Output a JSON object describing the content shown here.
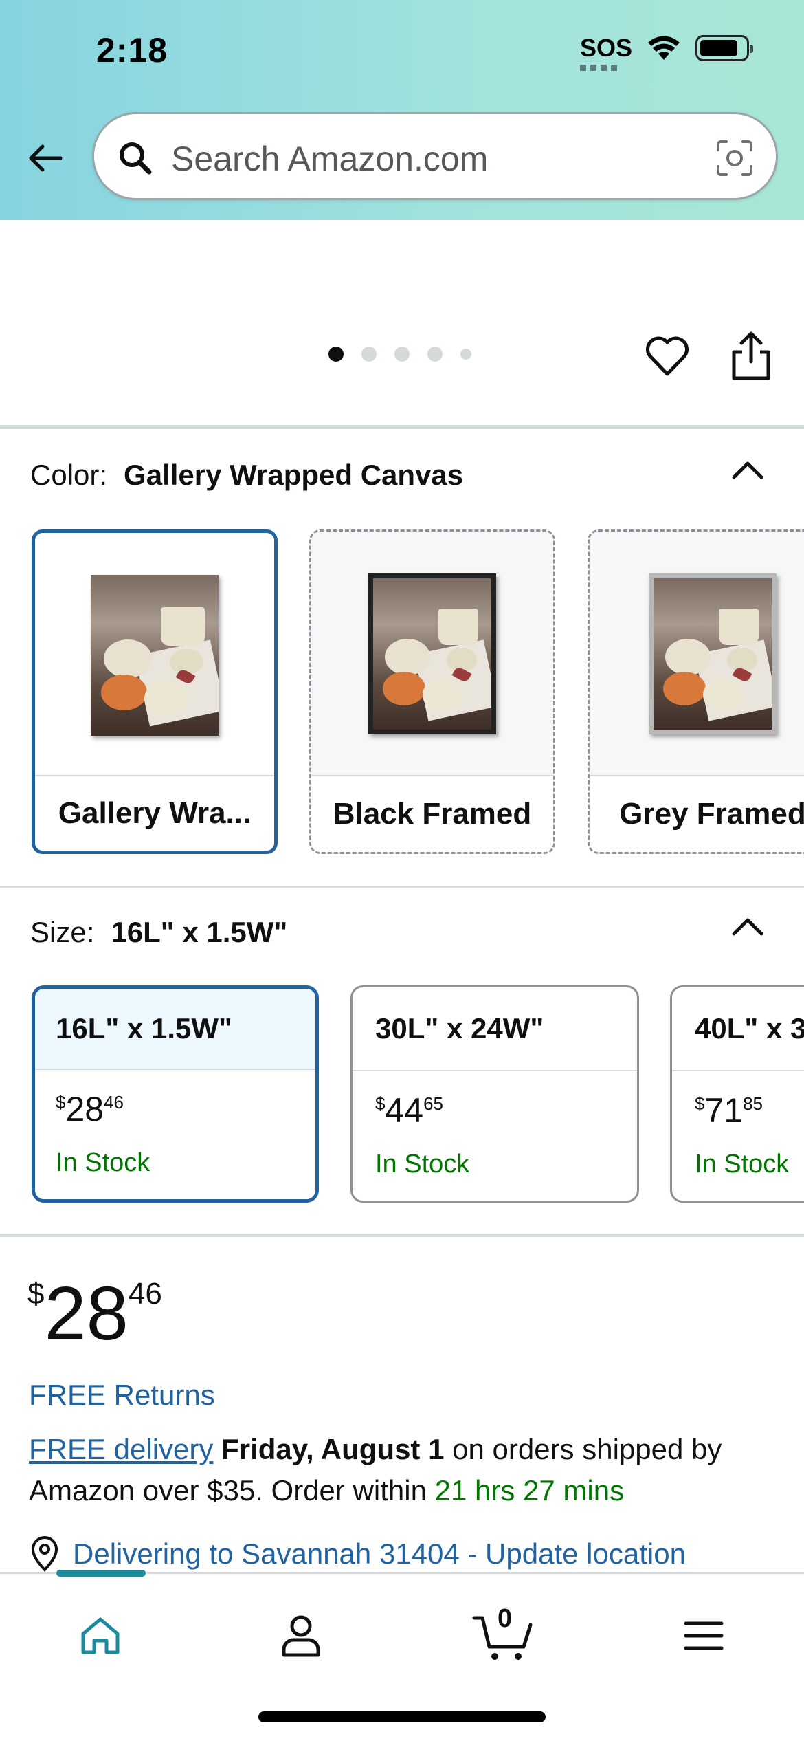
{
  "status_bar": {
    "time": "2:18",
    "sos": "SOS"
  },
  "search": {
    "placeholder": "Search Amazon.com"
  },
  "carousel": {
    "dots": 5,
    "active_index": 0
  },
  "color": {
    "label": "Color:",
    "selected": "Gallery Wrapped Canvas",
    "options": [
      {
        "label": "Gallery Wra...",
        "selected": true
      },
      {
        "label": "Black Framed",
        "selected": false
      },
      {
        "label": "Grey Framed",
        "selected": false
      }
    ]
  },
  "size": {
    "label": "Size:",
    "selected": "16L\" x 1.5W\"",
    "options": [
      {
        "label": "16L\" x 1.5W\"",
        "currency": "$",
        "dollars": "28",
        "cents": "46",
        "stock": "In Stock",
        "selected": true
      },
      {
        "label": "30L\" x 24W\"",
        "currency": "$",
        "dollars": "44",
        "cents": "65",
        "stock": "In Stock",
        "selected": false
      },
      {
        "label": "40L\" x 3",
        "currency": "$",
        "dollars": "71",
        "cents": "85",
        "stock": "In Stock",
        "selected": false
      }
    ]
  },
  "price": {
    "currency": "$",
    "dollars": "28",
    "cents": "46"
  },
  "free_returns": "FREE Returns",
  "delivery": {
    "link": "FREE delivery",
    "date": "Friday, August 1",
    "text_a": " on orders shipped by Amazon over $35. Order within ",
    "countdown": "21 hrs 27 mins"
  },
  "location": {
    "text": "Delivering to Savannah 31404 - Update location"
  },
  "nav": {
    "cart_count": "0"
  },
  "colors": {
    "link": "#2162a1",
    "stock_green": "#007600",
    "selected_border": "#2162a1",
    "accent_teal": "#1a8b9d"
  }
}
